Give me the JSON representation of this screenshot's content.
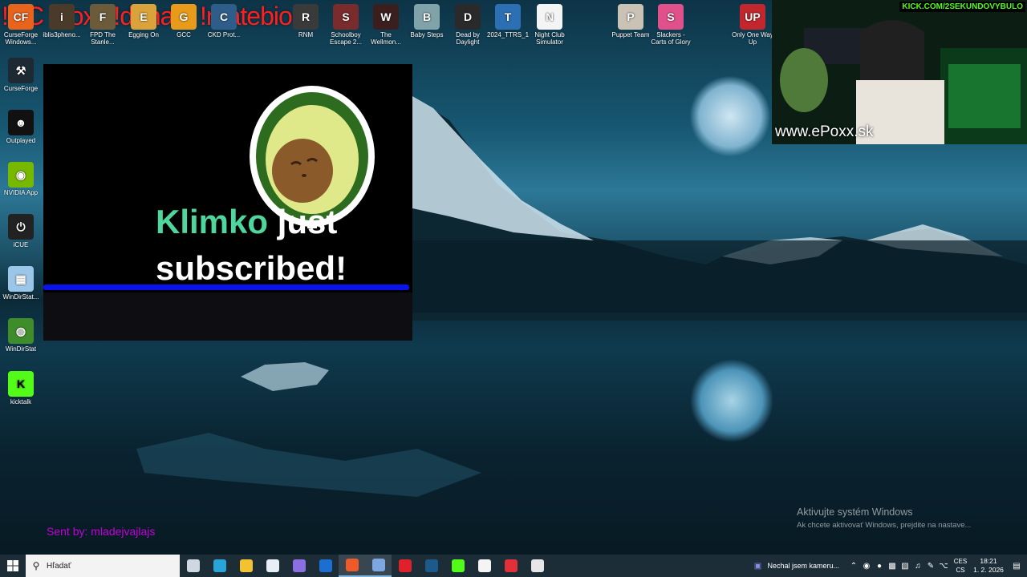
{
  "overlay": {
    "chat_commands": "!DC !doxx !donate !matebio"
  },
  "desktop": {
    "top_icons": [
      {
        "label": "CurseForge Windows...",
        "color": "#e8631c",
        "glyph": "CF"
      },
      {
        "label": "iblis3pheno...",
        "color": "#4a3a2a",
        "glyph": "i"
      },
      {
        "label": "FPD The Stanle...",
        "color": "#6b5b3b",
        "glyph": "F"
      },
      {
        "label": "Egging On",
        "color": "#d9a23a",
        "glyph": "E"
      },
      {
        "label": "GCC",
        "color": "#e89a1a",
        "glyph": "G"
      },
      {
        "label": "CKD Prot...",
        "color": "#2f5d8a",
        "glyph": "C"
      },
      {
        "label": "RNM",
        "color": "#3a3a3a",
        "glyph": "R"
      },
      {
        "label": "Schoolboy Escape 2...",
        "color": "#7a2b2b",
        "glyph": "S"
      },
      {
        "label": "The Wellmon...",
        "color": "#3b1f1f",
        "glyph": "W"
      },
      {
        "label": "Baby Steps",
        "color": "#7fa3a8",
        "glyph": "B"
      },
      {
        "label": "Dead by Daylight",
        "color": "#2a2a2a",
        "glyph": "D"
      },
      {
        "label": "2024_TTRS_1",
        "color": "#2c6fb3",
        "glyph": "T"
      },
      {
        "label": "Night Club Simulator",
        "color": "#f4f4f4",
        "glyph": "N"
      },
      {
        "label": "Puppet Team",
        "color": "#c9c2b5",
        "glyph": "P"
      },
      {
        "label": "Slackers - Carts of Glory",
        "color": "#e0508a",
        "glyph": "S"
      },
      {
        "label": "Only One Way Up",
        "color": "#c1272d",
        "glyph": "UP"
      }
    ],
    "left_icons": [
      {
        "label": "CurseForge",
        "color": "#1e2a33",
        "glyph": "⚒"
      },
      {
        "label": "Outplayed",
        "color": "#111",
        "glyph": "☻"
      },
      {
        "label": "NVIDIA App",
        "color": "#76b900",
        "glyph": "◉"
      },
      {
        "label": "iCUE",
        "color": "#222",
        "glyph": "⏻"
      },
      {
        "label": "WinDirStat...",
        "color": "#9cc6e8",
        "glyph": "▦"
      },
      {
        "label": "WinDirStat",
        "color": "#3f8d2a",
        "glyph": "◍"
      },
      {
        "label": "kicktalk",
        "color": "#53fc18",
        "glyph": "K"
      }
    ]
  },
  "alert": {
    "name": "Klimko",
    "text_rest": "just subscribed!",
    "sent_by": "Sent by: mladejvajlajs"
  },
  "webcam": {
    "site": "www.ePoxx.sk",
    "kick_handle": "KICK.COM/2SEKUNDOVYBULO"
  },
  "watermark": {
    "title": "Aktivujte systém Windows",
    "subtitle": "Ak chcete aktivovať Windows, prejdite na nastave..."
  },
  "taskbar": {
    "search_placeholder": "Hľadať",
    "apps": [
      {
        "name": "task-view",
        "color": "#cfd8e0",
        "active": false
      },
      {
        "name": "edge",
        "color": "#2aa3d8",
        "active": false
      },
      {
        "name": "file-explorer",
        "color": "#f2c230",
        "active": false
      },
      {
        "name": "store",
        "color": "#e7eef5",
        "active": false
      },
      {
        "name": "copilot",
        "color": "#8b6fe0",
        "active": false
      },
      {
        "name": "outlook",
        "color": "#1c6fd0",
        "active": false
      },
      {
        "name": "brave",
        "color": "#f05a28",
        "active": true
      },
      {
        "name": "app-blue",
        "color": "#7ea6e0",
        "active": true
      },
      {
        "name": "opera",
        "color": "#e0202a",
        "active": false
      },
      {
        "name": "steam",
        "color": "#1b5a8a",
        "active": false
      },
      {
        "name": "kick",
        "color": "#53fc18",
        "active": false
      },
      {
        "name": "obs",
        "color": "#f4f4f4",
        "active": false
      },
      {
        "name": "youtube-app",
        "color": "#e0303a",
        "active": false
      },
      {
        "name": "chrome",
        "color": "#e6e6e6",
        "active": false
      }
    ],
    "notification": "Nechal jsem kameru...",
    "lang_top": "CES",
    "lang_bottom": "CS",
    "time": "18:21",
    "date": "1. 2. 2026"
  }
}
